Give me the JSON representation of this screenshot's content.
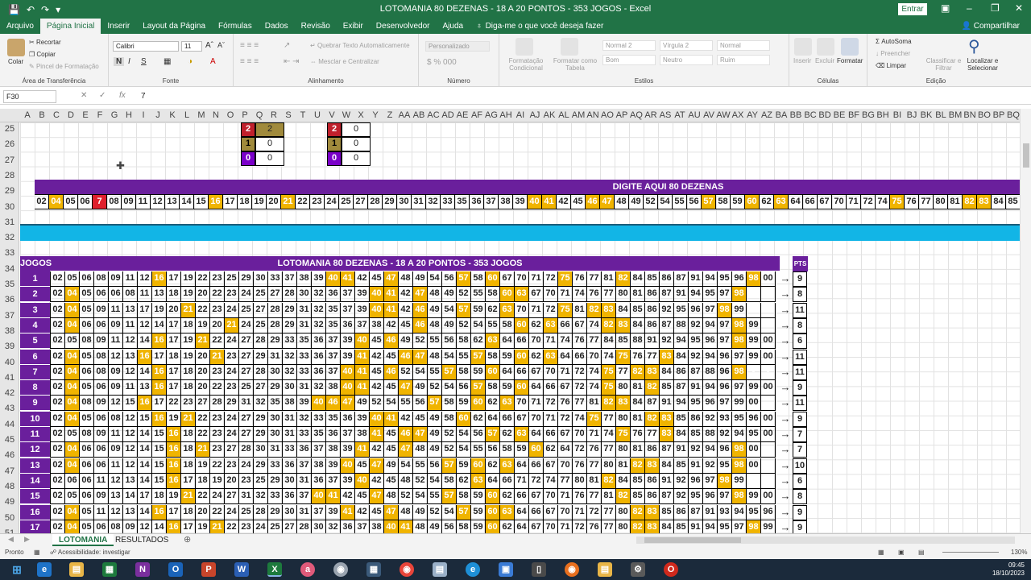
{
  "titlebar": {
    "title": "LOTOMANIA 80 DEZENAS - 18 A 20 PONTOS - 353 JOGOS  -  Excel",
    "enter": "Entrar"
  },
  "tabs": [
    "Arquivo",
    "Página Inicial",
    "Inserir",
    "Layout da Página",
    "Fórmulas",
    "Dados",
    "Revisão",
    "Exibir",
    "Desenvolvedor",
    "Ajuda"
  ],
  "tell_me": "Diga-me o que você deseja fazer",
  "share": "Compartilhar",
  "ribbon": {
    "clipboard": {
      "paste": "Colar",
      "cut": "Recortar",
      "copy": "Copiar",
      "painter": "Pincel de Formatação",
      "label": "Área de Transferência"
    },
    "font": {
      "name": "Calibri",
      "size": "11",
      "label": "Fonte"
    },
    "alignment": {
      "wrap": "Quebrar Texto Automaticamente",
      "merge": "Mesclar e Centralizar",
      "label": "Alinhamento"
    },
    "number": {
      "format": "Personalizado",
      "label": "Número"
    },
    "styles": {
      "cond": "Formatação Condicional",
      "table": "Formatar como Tabela",
      "normal2": "Normal 2",
      "virgula2": "Vírgula 2",
      "normal": "Normal",
      "bom": "Bom",
      "neutro": "Neutro",
      "ruim": "Ruim",
      "label": "Estilos"
    },
    "cells": {
      "insert": "Inserir",
      "delete": "Excluir",
      "format": "Formatar",
      "label": "Células"
    },
    "editing": {
      "autosum": "AutoSoma",
      "fill": "Preencher",
      "clear": "Limpar",
      "sort": "Classificar e Filtrar",
      "find": "Localizar e Selecionar",
      "label": "Edição"
    }
  },
  "formula_bar": {
    "namebox": "F30",
    "value": "7"
  },
  "columns": [
    "A",
    "B",
    "C",
    "D",
    "E",
    "F",
    "G",
    "H",
    "I",
    "J",
    "K",
    "L",
    "M",
    "N",
    "O",
    "P",
    "Q",
    "R",
    "S",
    "T",
    "U",
    "V",
    "W",
    "X",
    "Y",
    "Z",
    "AA",
    "AB",
    "AC",
    "AD",
    "AE",
    "AF",
    "AG",
    "AH",
    "AI",
    "AJ",
    "AK",
    "AL",
    "AM",
    "AN",
    "AO",
    "AP",
    "AQ",
    "AR",
    "AS",
    "AT",
    "AU",
    "AV",
    "AW",
    "AX",
    "AY",
    "AZ",
    "BA",
    "BB",
    "BC",
    "BD",
    "BE",
    "BF",
    "BG",
    "BH",
    "BI",
    "BJ",
    "BK",
    "BL",
    "BM",
    "BN",
    "BO",
    "BP",
    "BQ"
  ],
  "rows": [
    "25",
    "26",
    "27",
    "28",
    "29",
    "30",
    "31",
    "32",
    "33",
    "34",
    "35",
    "36",
    "37",
    "38",
    "39",
    "40",
    "41",
    "42",
    "43",
    "44",
    "45",
    "46",
    "47",
    "48",
    "49",
    "50",
    "51"
  ],
  "mini_tables": [
    {
      "rows": [
        [
          "2",
          "2"
        ],
        [
          "1",
          "0"
        ],
        [
          "0",
          "0"
        ]
      ]
    },
    {
      "rows": [
        [
          "2",
          "0"
        ],
        [
          "1",
          "0"
        ],
        [
          "0",
          "0"
        ]
      ]
    }
  ],
  "entry_banner": "DIGITE AQUI 80 DEZENAS",
  "entry_numbers": [
    "02",
    "04",
    "05",
    "06",
    "7",
    "08",
    "09",
    "11",
    "12",
    "13",
    "14",
    "15",
    "16",
    "17",
    "18",
    "19",
    "20",
    "21",
    "22",
    "23",
    "24",
    "25",
    "27",
    "28",
    "29",
    "30",
    "31",
    "32",
    "33",
    "35",
    "36",
    "37",
    "38",
    "39",
    "40",
    "41",
    "42",
    "45",
    "46",
    "47",
    "48",
    "49",
    "52",
    "54",
    "55",
    "56",
    "57",
    "58",
    "59",
    "60",
    "62",
    "63",
    "64",
    "66",
    "67",
    "70",
    "71",
    "72",
    "74",
    "75",
    "76",
    "77",
    "80",
    "81",
    "82",
    "83",
    "84",
    "85"
  ],
  "main_banner": "LOTOMANIA 80 DEZENAS - 18 A 20 PONTOS - 353 JOGOS",
  "jogos_header": "JOGOS",
  "pts_header": "PTS",
  "games": [
    {
      "n": "1",
      "pts": "9",
      "nums": [
        "02",
        "05",
        "06",
        "08",
        "09",
        "11",
        "12",
        "16",
        "17",
        "19",
        "22",
        "23",
        "25",
        "29",
        "30",
        "33",
        "37",
        "38",
        "39",
        "40",
        "41",
        "42",
        "45",
        "47",
        "48",
        "49",
        "54",
        "56",
        "57",
        "58",
        "60",
        "67",
        "70",
        "71",
        "72",
        "75",
        "76",
        "77",
        "81",
        "82",
        "84",
        "85",
        "86",
        "87",
        "91",
        "94",
        "95",
        "96",
        "98",
        "00"
      ]
    },
    {
      "n": "2",
      "pts": "8",
      "nums": [
        "02",
        "04",
        "05",
        "06",
        "06",
        "08",
        "11",
        "13",
        "18",
        "19",
        "20",
        "22",
        "23",
        "24",
        "25",
        "27",
        "28",
        "30",
        "32",
        "36",
        "37",
        "39",
        "40",
        "41",
        "42",
        "47",
        "48",
        "49",
        "52",
        "55",
        "58",
        "60",
        "63",
        "67",
        "70",
        "71",
        "74",
        "76",
        "77",
        "80",
        "81",
        "86",
        "87",
        "91",
        "94",
        "95",
        "97",
        "98",
        "-",
        "-"
      ]
    },
    {
      "n": "3",
      "pts": "11",
      "nums": [
        "02",
        "04",
        "05",
        "09",
        "11",
        "13",
        "17",
        "19",
        "20",
        "21",
        "22",
        "23",
        "24",
        "25",
        "27",
        "28",
        "29",
        "31",
        "32",
        "35",
        "37",
        "39",
        "40",
        "41",
        "42",
        "46",
        "49",
        "54",
        "57",
        "59",
        "62",
        "63",
        "70",
        "71",
        "72",
        "75",
        "81",
        "82",
        "83",
        "84",
        "85",
        "86",
        "92",
        "95",
        "96",
        "97",
        "98",
        "99",
        "-",
        "-"
      ]
    },
    {
      "n": "4",
      "pts": "8",
      "nums": [
        "02",
        "04",
        "06",
        "06",
        "09",
        "11",
        "12",
        "14",
        "17",
        "18",
        "19",
        "20",
        "21",
        "24",
        "25",
        "28",
        "29",
        "31",
        "32",
        "35",
        "36",
        "37",
        "38",
        "42",
        "45",
        "46",
        "48",
        "49",
        "52",
        "54",
        "55",
        "58",
        "60",
        "62",
        "63",
        "66",
        "67",
        "74",
        "82",
        "83",
        "84",
        "86",
        "87",
        "88",
        "92",
        "94",
        "97",
        "98",
        "99",
        "-"
      ]
    },
    {
      "n": "5",
      "pts": "6",
      "nums": [
        "02",
        "05",
        "08",
        "09",
        "11",
        "12",
        "14",
        "16",
        "17",
        "19",
        "21",
        "22",
        "24",
        "27",
        "28",
        "29",
        "33",
        "35",
        "36",
        "37",
        "39",
        "40",
        "45",
        "46",
        "49",
        "52",
        "55",
        "56",
        "58",
        "62",
        "63",
        "64",
        "66",
        "70",
        "71",
        "74",
        "76",
        "77",
        "84",
        "85",
        "88",
        "91",
        "92",
        "94",
        "95",
        "96",
        "97",
        "98",
        "99",
        "00"
      ]
    },
    {
      "n": "6",
      "pts": "11",
      "nums": [
        "02",
        "04",
        "05",
        "08",
        "12",
        "13",
        "16",
        "17",
        "18",
        "19",
        "20",
        "21",
        "23",
        "27",
        "29",
        "31",
        "32",
        "33",
        "36",
        "37",
        "39",
        "41",
        "42",
        "45",
        "46",
        "47",
        "48",
        "54",
        "55",
        "57",
        "58",
        "59",
        "60",
        "62",
        "63",
        "64",
        "66",
        "70",
        "74",
        "75",
        "76",
        "77",
        "83",
        "84",
        "92",
        "94",
        "96",
        "97",
        "99",
        "00"
      ]
    },
    {
      "n": "7",
      "pts": "11",
      "nums": [
        "02",
        "04",
        "06",
        "08",
        "09",
        "12",
        "14",
        "16",
        "17",
        "18",
        "20",
        "23",
        "24",
        "27",
        "28",
        "30",
        "32",
        "33",
        "36",
        "37",
        "40",
        "41",
        "45",
        "46",
        "52",
        "54",
        "55",
        "57",
        "58",
        "59",
        "60",
        "64",
        "66",
        "67",
        "70",
        "71",
        "72",
        "74",
        "75",
        "77",
        "82",
        "83",
        "84",
        "86",
        "87",
        "88",
        "96",
        "98",
        "-",
        "-"
      ]
    },
    {
      "n": "8",
      "pts": "9",
      "nums": [
        "02",
        "04",
        "05",
        "06",
        "09",
        "11",
        "13",
        "16",
        "17",
        "18",
        "20",
        "22",
        "23",
        "25",
        "27",
        "29",
        "30",
        "31",
        "32",
        "38",
        "40",
        "41",
        "42",
        "45",
        "47",
        "49",
        "52",
        "54",
        "56",
        "57",
        "58",
        "59",
        "60",
        "64",
        "66",
        "67",
        "72",
        "74",
        "75",
        "80",
        "81",
        "82",
        "85",
        "87",
        "91",
        "94",
        "96",
        "97",
        "99",
        "00"
      ]
    },
    {
      "n": "9",
      "pts": "11",
      "nums": [
        "02",
        "04",
        "08",
        "09",
        "12",
        "15",
        "16",
        "17",
        "22",
        "23",
        "27",
        "28",
        "29",
        "31",
        "32",
        "35",
        "38",
        "39",
        "40",
        "46",
        "47",
        "49",
        "52",
        "54",
        "55",
        "56",
        "57",
        "58",
        "59",
        "60",
        "62",
        "63",
        "70",
        "71",
        "72",
        "76",
        "77",
        "81",
        "82",
        "83",
        "84",
        "87",
        "91",
        "94",
        "95",
        "96",
        "97",
        "99",
        "00",
        "-"
      ]
    },
    {
      "n": "10",
      "pts": "9",
      "nums": [
        "02",
        "04",
        "05",
        "06",
        "08",
        "12",
        "15",
        "16",
        "19",
        "21",
        "22",
        "23",
        "24",
        "27",
        "29",
        "30",
        "31",
        "32",
        "33",
        "35",
        "36",
        "39",
        "40",
        "41",
        "42",
        "45",
        "49",
        "58",
        "60",
        "62",
        "64",
        "66",
        "67",
        "70",
        "71",
        "72",
        "74",
        "75",
        "77",
        "80",
        "81",
        "82",
        "83",
        "85",
        "86",
        "92",
        "93",
        "95",
        "96",
        "00"
      ]
    },
    {
      "n": "11",
      "pts": "7",
      "nums": [
        "02",
        "05",
        "08",
        "09",
        "11",
        "12",
        "14",
        "15",
        "16",
        "18",
        "22",
        "23",
        "24",
        "27",
        "29",
        "30",
        "31",
        "33",
        "35",
        "36",
        "37",
        "38",
        "41",
        "45",
        "46",
        "47",
        "49",
        "52",
        "54",
        "56",
        "57",
        "62",
        "63",
        "64",
        "66",
        "67",
        "70",
        "71",
        "74",
        "75",
        "76",
        "77",
        "83",
        "84",
        "85",
        "88",
        "92",
        "94",
        "95",
        "00"
      ]
    },
    {
      "n": "12",
      "pts": "7",
      "nums": [
        "02",
        "04",
        "06",
        "06",
        "09",
        "12",
        "14",
        "15",
        "16",
        "18",
        "21",
        "23",
        "27",
        "28",
        "30",
        "31",
        "33",
        "36",
        "37",
        "38",
        "39",
        "41",
        "42",
        "45",
        "47",
        "48",
        "49",
        "52",
        "54",
        "55",
        "56",
        "58",
        "59",
        "60",
        "62",
        "64",
        "72",
        "76",
        "77",
        "80",
        "81",
        "86",
        "87",
        "91",
        "92",
        "94",
        "96",
        "98",
        "00",
        "-"
      ]
    },
    {
      "n": "13",
      "pts": "10",
      "nums": [
        "02",
        "04",
        "06",
        "06",
        "11",
        "12",
        "14",
        "15",
        "16",
        "18",
        "19",
        "22",
        "23",
        "24",
        "29",
        "33",
        "36",
        "37",
        "38",
        "39",
        "40",
        "45",
        "47",
        "49",
        "54",
        "55",
        "56",
        "57",
        "59",
        "60",
        "62",
        "63",
        "64",
        "66",
        "67",
        "70",
        "76",
        "77",
        "80",
        "81",
        "82",
        "83",
        "84",
        "85",
        "91",
        "92",
        "95",
        "98",
        "00",
        "-"
      ]
    },
    {
      "n": "14",
      "pts": "6",
      "nums": [
        "02",
        "06",
        "06",
        "11",
        "12",
        "13",
        "14",
        "15",
        "16",
        "17",
        "18",
        "19",
        "20",
        "23",
        "25",
        "29",
        "30",
        "31",
        "36",
        "37",
        "39",
        "40",
        "42",
        "45",
        "48",
        "52",
        "54",
        "58",
        "62",
        "63",
        "64",
        "66",
        "71",
        "72",
        "74",
        "77",
        "80",
        "81",
        "82",
        "84",
        "85",
        "86",
        "91",
        "92",
        "96",
        "97",
        "98",
        "99",
        "-",
        "-"
      ]
    },
    {
      "n": "15",
      "pts": "8",
      "nums": [
        "02",
        "05",
        "06",
        "09",
        "13",
        "14",
        "17",
        "18",
        "19",
        "21",
        "22",
        "24",
        "27",
        "31",
        "32",
        "33",
        "36",
        "37",
        "40",
        "41",
        "42",
        "45",
        "47",
        "48",
        "52",
        "54",
        "55",
        "57",
        "58",
        "59",
        "60",
        "62",
        "66",
        "67",
        "70",
        "71",
        "76",
        "77",
        "81",
        "82",
        "85",
        "86",
        "87",
        "92",
        "95",
        "96",
        "97",
        "98",
        "99",
        "00"
      ]
    },
    {
      "n": "16",
      "pts": "9",
      "nums": [
        "02",
        "04",
        "05",
        "11",
        "12",
        "13",
        "14",
        "16",
        "17",
        "18",
        "20",
        "22",
        "24",
        "25",
        "28",
        "29",
        "30",
        "31",
        "37",
        "39",
        "41",
        "42",
        "45",
        "47",
        "48",
        "49",
        "52",
        "54",
        "57",
        "59",
        "60",
        "63",
        "64",
        "66",
        "67",
        "70",
        "71",
        "72",
        "77",
        "80",
        "82",
        "83",
        "85",
        "86",
        "87",
        "91",
        "93",
        "94",
        "95",
        "96"
      ]
    },
    {
      "n": "17",
      "pts": "9",
      "nums": [
        "02",
        "04",
        "05",
        "06",
        "08",
        "09",
        "12",
        "14",
        "16",
        "17",
        "19",
        "21",
        "22",
        "23",
        "24",
        "25",
        "27",
        "28",
        "30",
        "32",
        "36",
        "37",
        "38",
        "40",
        "41",
        "48",
        "49",
        "56",
        "58",
        "59",
        "60",
        "62",
        "64",
        "67",
        "70",
        "71",
        "72",
        "76",
        "77",
        "80",
        "82",
        "83",
        "84",
        "85",
        "91",
        "94",
        "95",
        "97",
        "98",
        "99"
      ]
    }
  ],
  "sheets": [
    "LOTOMANIA",
    "RESULTADOS"
  ],
  "status": {
    "ready": "Pronto",
    "access": "Acessibilidade: investigar",
    "zoom": "130%"
  },
  "clock": {
    "time": "09:45",
    "date": "18/10/2023"
  },
  "colors": {
    "excel_green": "#217346",
    "purple": "#6a1f9c",
    "gold": "#f0b400",
    "red": "#e0202c",
    "cyan": "#12b5e6"
  }
}
